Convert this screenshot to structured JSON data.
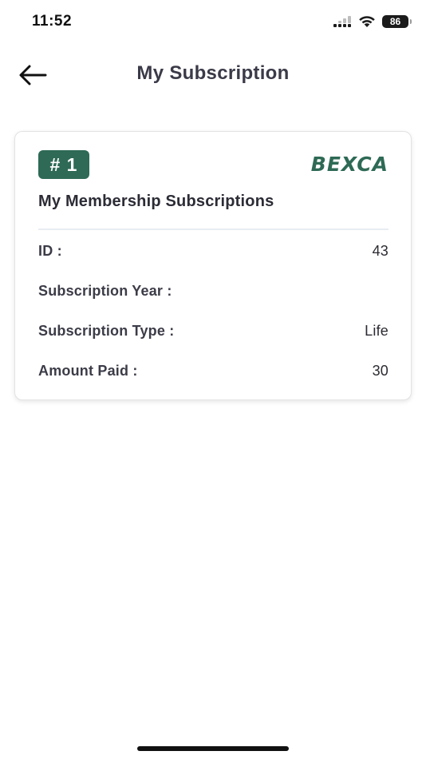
{
  "status_bar": {
    "time": "11:52",
    "battery_level": "86",
    "icons": [
      "cellular-signal-icon",
      "wifi-icon",
      "battery-icon"
    ]
  },
  "header": {
    "back_icon": "arrow-left-icon",
    "title": "My Subscription"
  },
  "subscription_card": {
    "index_badge": "# 1",
    "brand": "BEXCA",
    "title": "My Membership Subscriptions",
    "details": [
      {
        "label": "ID :",
        "value": "43"
      },
      {
        "label": "Subscription Year :",
        "value": ""
      },
      {
        "label": "Subscription Type :",
        "value": "Life"
      },
      {
        "label": "Amount Paid :",
        "value": "30"
      }
    ]
  },
  "colors": {
    "brand_green": "#2e6a55",
    "title_text": "#3a3a48",
    "divider": "#e9ecf3"
  }
}
